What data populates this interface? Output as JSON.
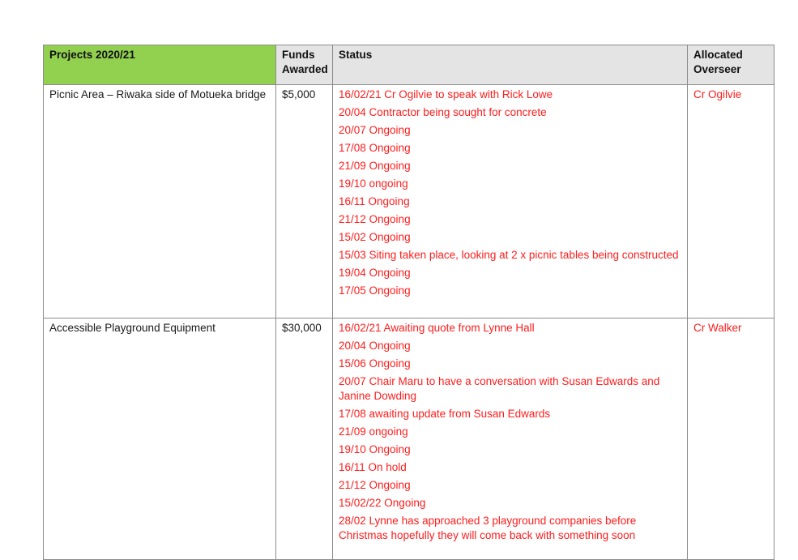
{
  "table": {
    "headers": {
      "project": "Projects 2020/21",
      "funds": "Funds Awarded",
      "status": "Status",
      "overseer": "Allocated Overseer"
    },
    "header_colors": {
      "project_bg": "#92d050",
      "other_bg": "#e4e4e4"
    },
    "status_color": "#ff1c1c",
    "rows": [
      {
        "project": "Picnic Area – Riwaka side of Motueka bridge",
        "funds": "$5,000",
        "status": [
          "16/02/21 Cr Ogilvie to speak with Rick Lowe",
          "20/04 Contractor being sought for concrete",
          "20/07 Ongoing",
          "17/08 Ongoing",
          "21/09 Ongoing",
          "19/10 ongoing",
          "16/11 Ongoing",
          "21/12 Ongoing",
          "15/02 Ongoing",
          "15/03 Siting taken place, looking at 2 x picnic tables being constructed",
          "19/04 Ongoing",
          "17/05 Ongoing"
        ],
        "overseer": "Cr Ogilvie"
      },
      {
        "project": "Accessible Playground Equipment",
        "funds": "$30,000",
        "status": [
          "16/02/21 Awaiting quote from Lynne Hall",
          "20/04 Ongoing",
          "15/06 Ongoing",
          "20/07 Chair Maru to have a conversation with Susan Edwards and Janine Dowding",
          "17/08 awaiting update from Susan Edwards",
          "21/09 ongoing",
          "19/10 Ongoing",
          "16/11 On hold",
          "21/12 Ongoing",
          "15/02/22 Ongoing",
          "28/02 Lynne has approached 3 playground companies before Christmas hopefully they will come back with something soon"
        ],
        "overseer": "Cr Walker"
      }
    ]
  }
}
